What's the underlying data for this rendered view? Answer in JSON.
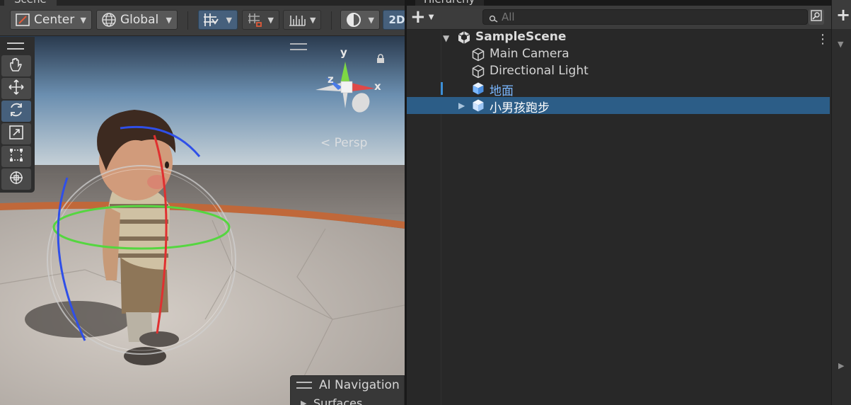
{
  "scene_panel": {
    "tab_label": "Scene",
    "toolbar": {
      "pivot_mode": "Center",
      "space_mode": "Global",
      "mode_2d": "2D"
    },
    "tools": [
      "hand-icon",
      "move-icon",
      "rotate-icon",
      "scale-icon",
      "rect-icon",
      "transform-icon"
    ],
    "active_tool": "rotate-icon",
    "gizmo": {
      "axis_y": "y",
      "axis_x": "x",
      "axis_z": "z",
      "projection": "< Persp"
    },
    "overlay": {
      "title": "AI Navigation",
      "item": "Surfaces"
    }
  },
  "hierarchy_panel": {
    "tab_label": "Hierarchy",
    "add_label": "+",
    "search_placeholder": "All",
    "scene_name": "SampleScene",
    "items": [
      {
        "label": "Main Camera",
        "type": "gameobject"
      },
      {
        "label": "Directional Light",
        "type": "gameobject"
      },
      {
        "label": "地面",
        "type": "prefab"
      },
      {
        "label": "小男孩跑步",
        "type": "prefab",
        "selected": true
      }
    ]
  },
  "colors": {
    "selection": "#2c5d87",
    "prefab_text": "#7ab7ff",
    "active_tool": "#46607c"
  }
}
